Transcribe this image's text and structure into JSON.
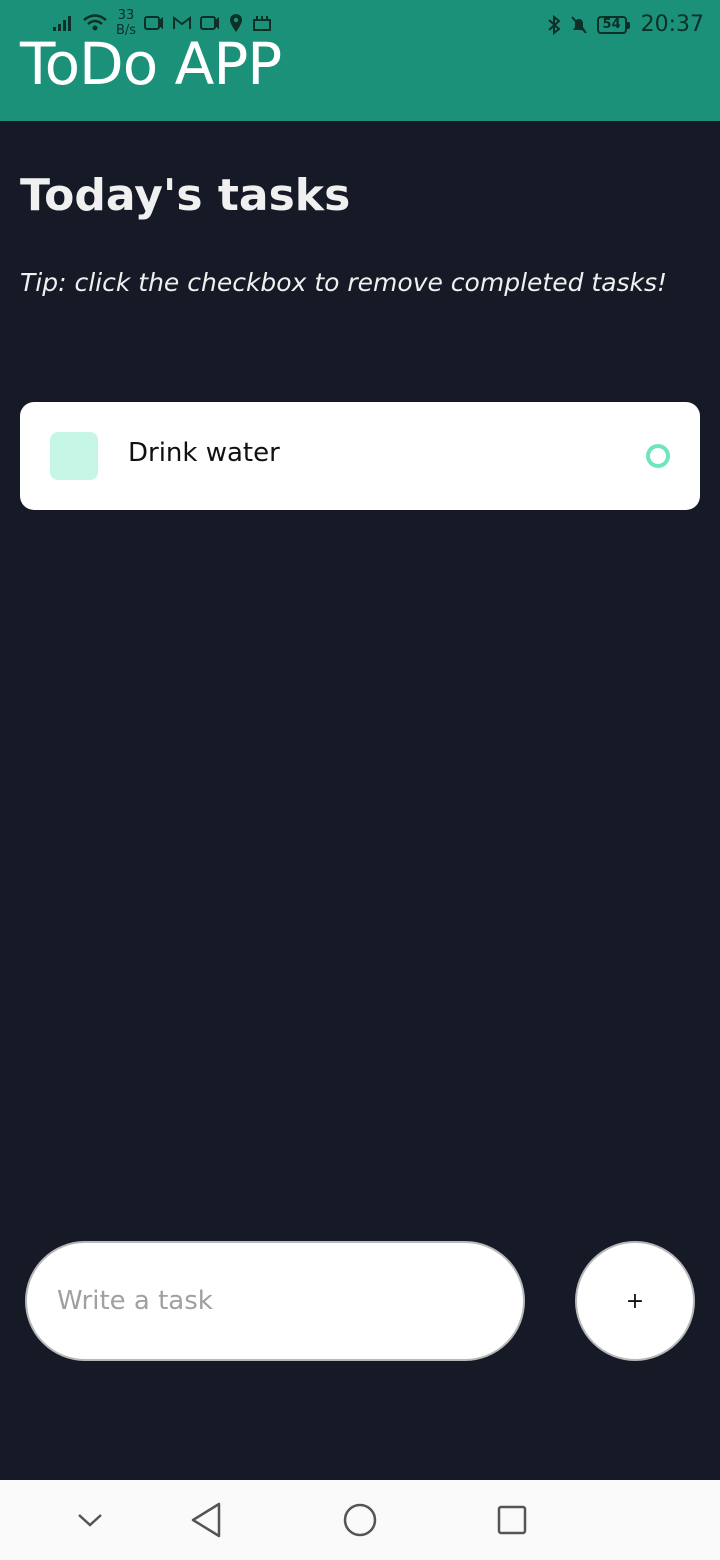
{
  "status_bar": {
    "net_speed_value": "33",
    "net_speed_unit": "B/s",
    "battery": "54",
    "time": "20:37",
    "icons_left": [
      "signal-icon",
      "wifi-icon",
      "notification-icon",
      "gmail-icon",
      "notification-icon",
      "location-icon",
      "notification-icon"
    ],
    "icons_right": [
      "bluetooth-icon",
      "mute-icon",
      "battery-icon"
    ]
  },
  "header": {
    "title": "ToDo APP",
    "color": "#1c917a"
  },
  "main": {
    "section_title": "Today's tasks",
    "tip": "Tip: click the checkbox to remove completed tasks!",
    "tasks": [
      {
        "label": "Drink water"
      }
    ]
  },
  "composer": {
    "placeholder": "Write a task",
    "add_label": "+"
  },
  "nav": {
    "items": [
      "chevron-down-icon",
      "back-icon",
      "home-icon",
      "recents-icon"
    ]
  },
  "colors": {
    "background": "#151a26",
    "accent_light": "#c6f6e6",
    "accent": "#6ee5bf"
  }
}
